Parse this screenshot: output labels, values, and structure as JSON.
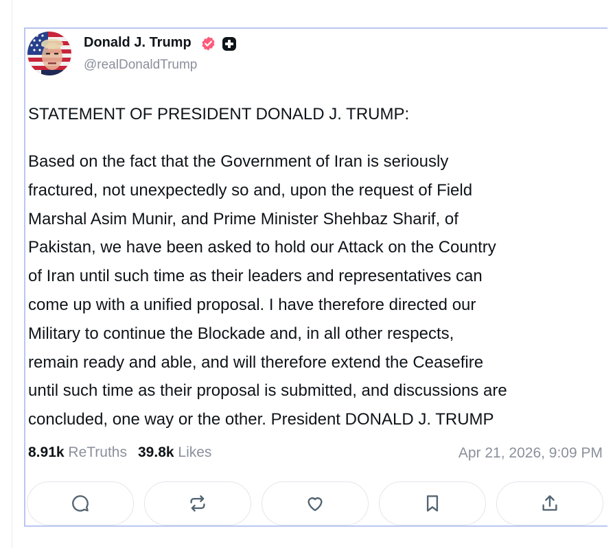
{
  "post": {
    "author": {
      "name": "Donald J. Trump",
      "handle": "@realDonaldTrump",
      "verified_icon": "verified-badge-icon",
      "extra_icon": "plus-badge-icon"
    },
    "heading": "STATEMENT OF PRESIDENT DONALD J. TRUMP:",
    "body_lines": [
      "Based on the fact that the Government of Iran is seriously",
      "fractured, not unexpectedly so and, upon the request of Field",
      "Marshal Asim Munir, and Prime Minister Shehbaz Sharif, of",
      "Pakistan, we have been asked to hold our Attack on the Country",
      "of Iran until such time as their leaders and representatives can",
      "come up with a unified proposal. I have therefore directed our",
      "Military to continue the Blockade and, in all other respects,",
      "remain ready and able, and will therefore extend the Ceasefire",
      "until such time as their proposal is submitted, and discussions are",
      "concluded, one way or the other. President DONALD J. TRUMP"
    ],
    "stats": {
      "retruths_count": "8.91k",
      "retruths_label": "ReTruths",
      "likes_count": "39.8k",
      "likes_label": "Likes"
    },
    "timestamp": "Apr 21, 2026, 9:09 PM",
    "actions": [
      "reply-icon",
      "retruth-icon",
      "like-icon",
      "bookmark-icon",
      "share-icon"
    ]
  },
  "colors": {
    "border": "#b9c6f0",
    "verified": "#ff5a7a",
    "muted_text": "#8a8f9a",
    "text": "#0f1419"
  }
}
